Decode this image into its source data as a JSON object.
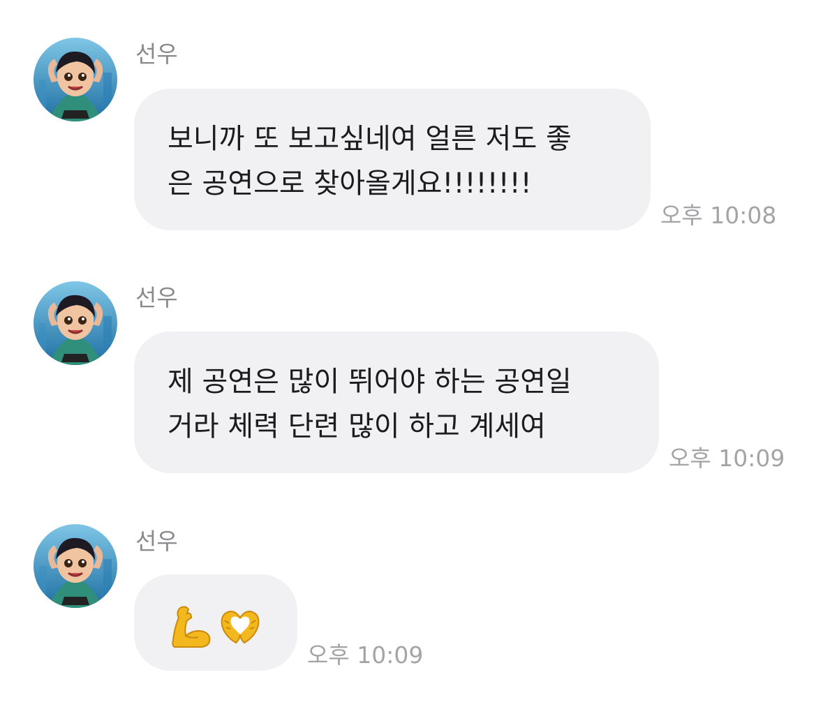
{
  "messages": [
    {
      "sender": "선우",
      "avatar_icon": "profile-avatar-icon",
      "lines": [
        "보니까 또 보고싶네여 얼른 저도 좋",
        "은 공연으로 찾아올게요!!!!!!!!"
      ],
      "time": "오후 10:08"
    },
    {
      "sender": "선우",
      "avatar_icon": "profile-avatar-icon",
      "lines": [
        "제 공연은 많이 뛰어야 하는 공연일",
        "거라 체력 단련 많이 하고 계세여"
      ],
      "time": "오후 10:09"
    },
    {
      "sender": "선우",
      "avatar_icon": "profile-avatar-icon",
      "emojis": [
        "flexed-biceps-icon",
        "heart-hands-icon"
      ],
      "time": "오후 10:09"
    }
  ],
  "colors": {
    "bubble": "#f1f1f4",
    "text": "#1c1c1e",
    "sender": "#8a8a8e",
    "time": "#a3a3a8",
    "emoji": "#f3b81d"
  }
}
